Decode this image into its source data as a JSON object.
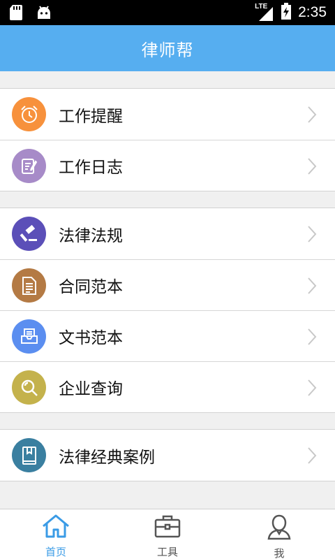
{
  "status_bar": {
    "network": "LTE",
    "time": "2:35"
  },
  "app_bar": {
    "title": "律师帮"
  },
  "groups": [
    {
      "items": [
        {
          "label": "工作提醒",
          "icon": "alarm-clock-icon",
          "color": "#f7913c"
        },
        {
          "label": "工作日志",
          "icon": "notebook-pen-icon",
          "color": "#a78bc8"
        }
      ]
    },
    {
      "items": [
        {
          "label": "法律法规",
          "icon": "gavel-icon",
          "color": "#5b4fb8"
        },
        {
          "label": "合同范本",
          "icon": "document-icon",
          "color": "#b47a44"
        },
        {
          "label": "文书范本",
          "icon": "inbox-tray-icon",
          "color": "#5b8ef0"
        },
        {
          "label": "企业查询",
          "icon": "magnifier-icon",
          "color": "#c4b24c"
        }
      ]
    },
    {
      "items": [
        {
          "label": "法律经典案例",
          "icon": "book-icon",
          "color": "#3a7fa0"
        }
      ]
    }
  ],
  "tabs": [
    {
      "label": "首页",
      "icon": "home-icon",
      "active": true
    },
    {
      "label": "工具",
      "icon": "toolbox-icon",
      "active": false
    },
    {
      "label": "我",
      "icon": "user-icon",
      "active": false
    }
  ],
  "colors": {
    "accent": "#56aef0",
    "tab_active": "#3a9be6"
  }
}
